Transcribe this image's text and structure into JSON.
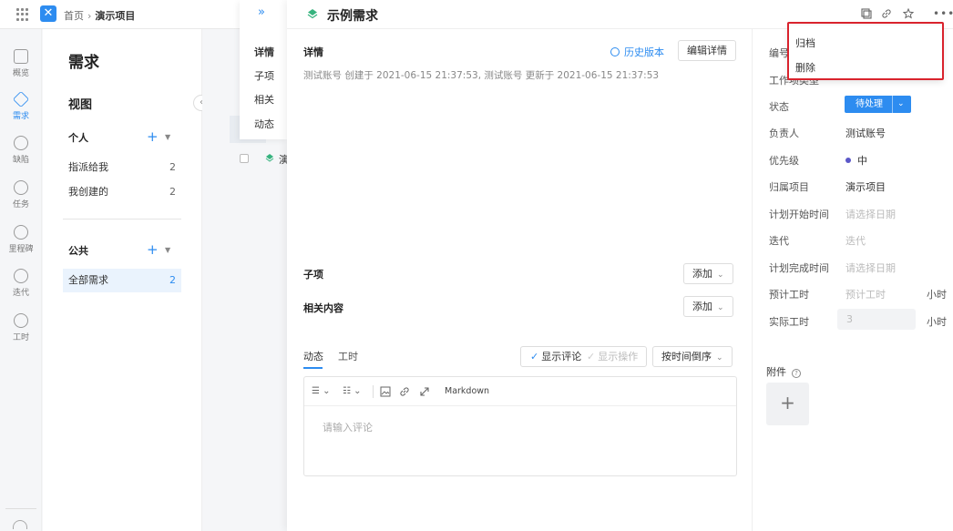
{
  "topbar": {
    "home": "首页",
    "project": "演示项目"
  },
  "rail": {
    "items": [
      "概览",
      "需求",
      "缺陷",
      "任务",
      "里程碑",
      "迭代",
      "工时"
    ]
  },
  "nav": {
    "title": "需求",
    "view_title": "视图",
    "personal": "个人",
    "personal_items": [
      {
        "label": "指派给我",
        "count": "2"
      },
      {
        "label": "我创建的",
        "count": "2"
      }
    ],
    "public": "公共",
    "public_items": [
      {
        "label": "全部需求",
        "count": "2"
      }
    ]
  },
  "list": {
    "row_fragment": "演"
  },
  "drawer_tabs": [
    "详情",
    "子项",
    "相关",
    "动态"
  ],
  "drawer": {
    "title": "示例需求",
    "details_title": "详情",
    "history": "历史版本",
    "edit_details": "编辑详情",
    "meta": "测试账号 创建于 2021-06-15 21:37:53, 测试账号 更新于 2021-06-15 21:37:53",
    "subitems": "子项",
    "related": "相关内容",
    "add": "添加",
    "tabs": [
      "动态",
      "工时"
    ],
    "show_comments": "显示评论",
    "show_ops": "显示操作",
    "sort": "按时间倒序",
    "markdown": "Markdown",
    "comment_placeholder": "请输入评论"
  },
  "props": {
    "id_label": "编号",
    "type_label": "工作项类型",
    "status_label": "状态",
    "status_value": "待处理",
    "assignee_label": "负责人",
    "assignee_value": "测试账号",
    "priority_label": "优先级",
    "priority_value": "中",
    "project_label": "归属项目",
    "project_value": "演示项目",
    "start_label": "计划开始时间",
    "start_value": "请选择日期",
    "iteration_label": "迭代",
    "iteration_value": "迭代",
    "end_label": "计划完成时间",
    "end_value": "请选择日期",
    "est_label": "预计工时",
    "est_value": "预计工时",
    "actual_label": "实际工时",
    "actual_value": "3",
    "unit": "小时",
    "attachments": "附件"
  },
  "menu": {
    "archive": "归档",
    "delete": "删除"
  },
  "colors": {
    "accent": "#2d8cf0",
    "highlight": "#d9232d",
    "priority_medium": "#5b57c8"
  }
}
